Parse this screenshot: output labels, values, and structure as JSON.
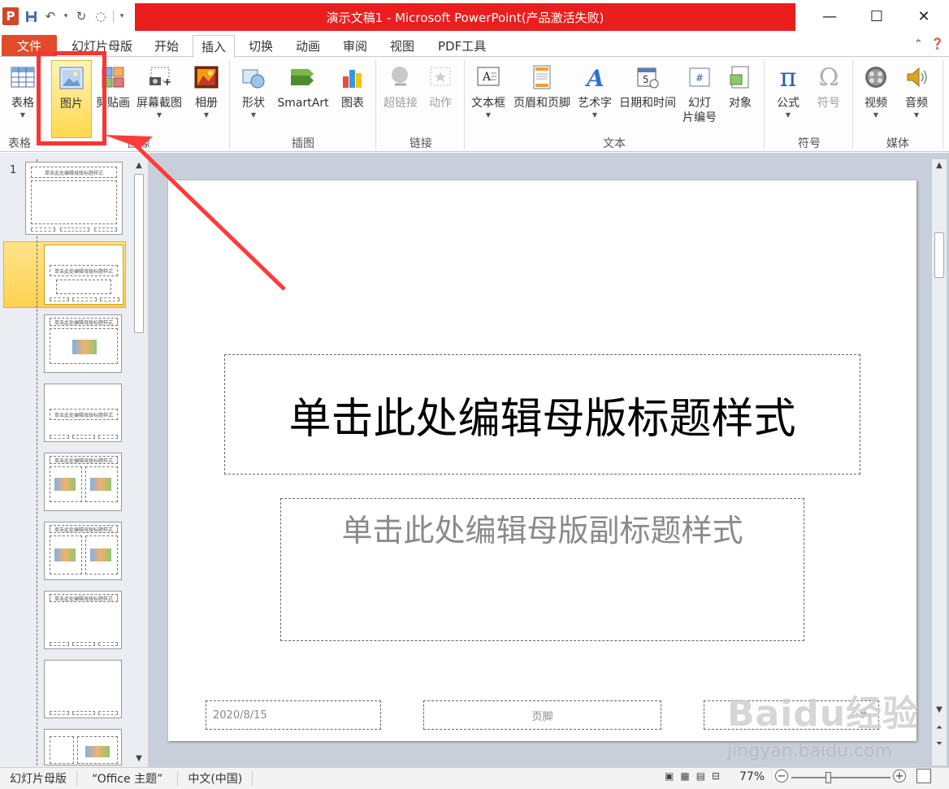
{
  "window": {
    "title": "演示文稿1 - Microsoft PowerPoint(产品激活失败)",
    "app_icon": "P"
  },
  "tabs": [
    "文件",
    "幻灯片母版",
    "开始",
    "插入",
    "切换",
    "动画",
    "审阅",
    "视图",
    "PDF工具"
  ],
  "active_tab": "插入",
  "ribbon": {
    "buttons": [
      {
        "label": "表格",
        "icon": "table-icon",
        "dropdown": true,
        "disabled": false
      },
      {
        "label": "图片",
        "icon": "picture-icon",
        "dropdown": false,
        "disabled": false
      },
      {
        "label": "剪贴画",
        "icon": "clipart-icon",
        "dropdown": false,
        "disabled": false
      },
      {
        "label": "屏幕截图",
        "icon": "screenshot-icon",
        "dropdown": true,
        "disabled": false
      },
      {
        "label": "相册",
        "icon": "album-icon",
        "dropdown": true,
        "disabled": false
      },
      {
        "label": "形状",
        "icon": "shapes-icon",
        "dropdown": true,
        "disabled": false
      },
      {
        "label": "SmartArt",
        "icon": "smartart-icon",
        "dropdown": false,
        "disabled": false
      },
      {
        "label": "图表",
        "icon": "chart-icon",
        "dropdown": false,
        "disabled": false
      },
      {
        "label": "超链接",
        "icon": "hyperlink-icon",
        "dropdown": false,
        "disabled": true
      },
      {
        "label": "动作",
        "icon": "action-icon",
        "dropdown": false,
        "disabled": true
      },
      {
        "label": "文本框",
        "icon": "textbox-icon",
        "dropdown": true,
        "disabled": false
      },
      {
        "label": "页眉和页脚",
        "icon": "header-footer-icon",
        "dropdown": false,
        "disabled": false
      },
      {
        "label": "艺术字",
        "icon": "wordart-icon",
        "dropdown": true,
        "disabled": false
      },
      {
        "label": "日期和时间",
        "icon": "datetime-icon",
        "dropdown": false,
        "disabled": false
      },
      {
        "label": "幻灯",
        "label2": "片编号",
        "icon": "slide-number-icon",
        "dropdown": false,
        "disabled": false
      },
      {
        "label": "对象",
        "icon": "object-icon",
        "dropdown": false,
        "disabled": false
      },
      {
        "label": "公式",
        "icon": "equation-icon",
        "dropdown": true,
        "disabled": false
      },
      {
        "label": "符号",
        "icon": "symbol-icon",
        "dropdown": false,
        "disabled": true
      },
      {
        "label": "视频",
        "icon": "video-icon",
        "dropdown": true,
        "disabled": false
      },
      {
        "label": "音频",
        "icon": "audio-icon",
        "dropdown": true,
        "disabled": false
      }
    ],
    "groups": [
      "表格",
      "图像",
      "插图",
      "链接",
      "文本",
      "符号",
      "媒体"
    ]
  },
  "thumbnails": {
    "slide_number": "1",
    "master_title": "单击此处编辑母版标题样式"
  },
  "slide": {
    "title": "单击此处编辑母版标题样式",
    "subtitle": "单击此处编辑母版副标题样式",
    "date": "2020/8/15",
    "footer": "页脚",
    "number": "‹#›"
  },
  "statusbar": {
    "view": "幻灯片母版",
    "theme": "“Office 主题”",
    "language": "中文(中国)",
    "zoom": "77%"
  },
  "watermark": {
    "brand": "Baidu经验",
    "url": "jingyan.baidu.com"
  },
  "colors": {
    "file_tab": "#e34a2a",
    "title_highlight": "#ec1d1d",
    "annotation": "#ff3333",
    "selected_button": "#ffd84d"
  }
}
